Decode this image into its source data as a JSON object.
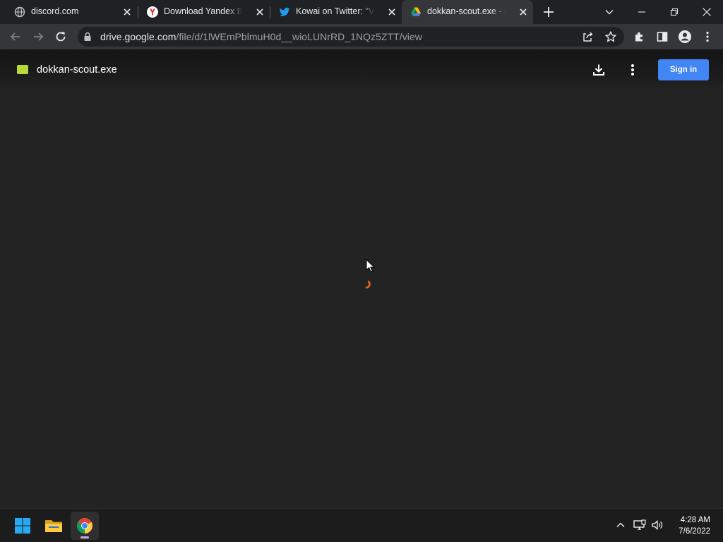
{
  "tabs": [
    {
      "title": "discord.com",
      "icon": "globe-icon"
    },
    {
      "title": "Download Yandex Browser",
      "icon": "yandex-icon"
    },
    {
      "title": "Kowai on Twitter: \"Voila",
      "icon": "twitter-icon"
    },
    {
      "title": "dokkan-scout.exe - Google Drive",
      "icon": "google-drive-icon",
      "active": true
    }
  ],
  "address_bar": {
    "host": "drive.google.com",
    "path": "/file/d/1lWEmPblmuH0d__wioLUNrRD_1NQz5ZTT/view"
  },
  "drive": {
    "file_name": "dokkan-scout.exe",
    "sign_in_label": "Sign in",
    "loading": true
  },
  "taskbar": {
    "apps": [
      "windows-start",
      "file-explorer",
      "chrome"
    ],
    "time": "4:28 AM",
    "date": "7/6/2022"
  },
  "colors": {
    "page_bg": "#232323",
    "tab_strip": "#202124",
    "toolbar": "#35363a",
    "sign_in": "#4285f4",
    "spinner": "#e8642c",
    "file_icon": "#b8d93a"
  }
}
